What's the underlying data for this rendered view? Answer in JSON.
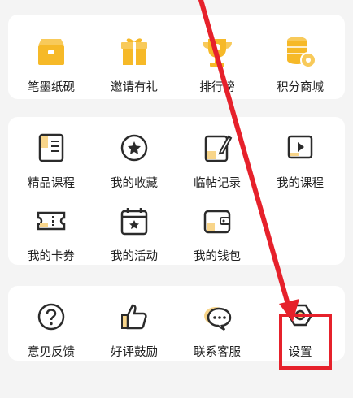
{
  "sections": [
    {
      "items": [
        {
          "label": "笔墨纸砚",
          "icon": "box-icon"
        },
        {
          "label": "邀请有礼",
          "icon": "gift-icon"
        },
        {
          "label": "排行榜",
          "icon": "trophy-icon"
        },
        {
          "label": "积分商城",
          "icon": "coins-icon"
        }
      ]
    },
    {
      "items": [
        {
          "label": "精品课程",
          "icon": "book-icon"
        },
        {
          "label": "我的收藏",
          "icon": "star-icon"
        },
        {
          "label": "临帖记录",
          "icon": "notebook-pen-icon"
        },
        {
          "label": "我的课程",
          "icon": "video-play-icon"
        },
        {
          "label": "我的卡券",
          "icon": "ticket-icon"
        },
        {
          "label": "我的活动",
          "icon": "calendar-icon"
        },
        {
          "label": "我的钱包",
          "icon": "wallet-icon"
        }
      ]
    },
    {
      "items": [
        {
          "label": "意见反馈",
          "icon": "question-icon"
        },
        {
          "label": "好评鼓励",
          "icon": "thumbs-up-icon"
        },
        {
          "label": "联系客服",
          "icon": "chat-icon"
        },
        {
          "label": "设置",
          "icon": "settings-icon"
        }
      ]
    }
  ],
  "colors": {
    "accent": "#f6b928",
    "stroke": "#2b2b2b",
    "annotation": "#e6212b"
  }
}
